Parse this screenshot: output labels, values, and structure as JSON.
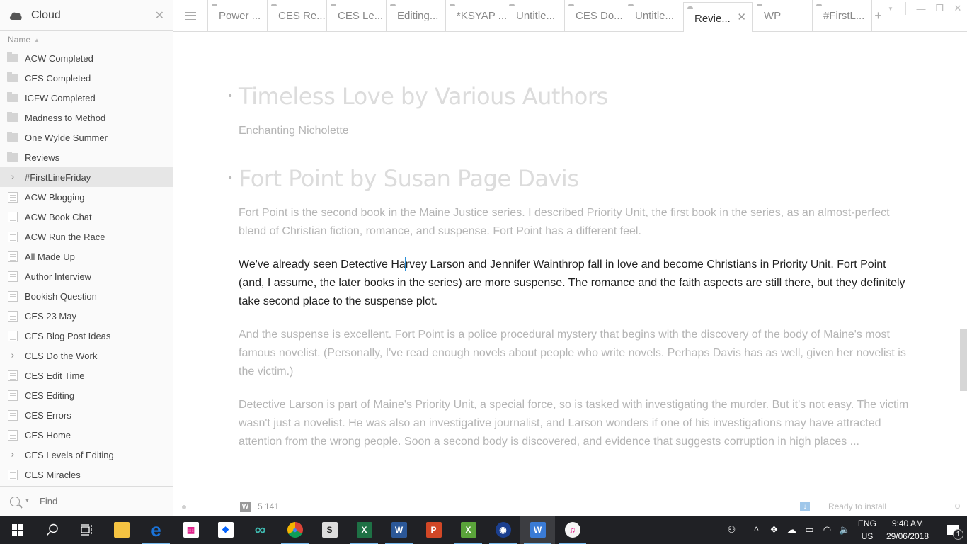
{
  "sidebar": {
    "title": "Cloud",
    "sort_label": "Name",
    "items": [
      {
        "label": "ACW Completed",
        "type": "folder"
      },
      {
        "label": "CES Completed",
        "type": "folder"
      },
      {
        "label": "ICFW Completed",
        "type": "folder"
      },
      {
        "label": "Madness to Method",
        "type": "folder"
      },
      {
        "label": "One Wylde Summer",
        "type": "folder"
      },
      {
        "label": "Reviews",
        "type": "folder"
      },
      {
        "label": "#FirstLineFriday",
        "type": "expandable",
        "selected": true
      },
      {
        "label": "ACW Blogging",
        "type": "doc"
      },
      {
        "label": "ACW Book Chat",
        "type": "doc"
      },
      {
        "label": "ACW Run the Race",
        "type": "doc"
      },
      {
        "label": "All Made Up",
        "type": "doc"
      },
      {
        "label": "Author Interview",
        "type": "doc"
      },
      {
        "label": "Bookish Question",
        "type": "doc"
      },
      {
        "label": "CES 23 May",
        "type": "doc"
      },
      {
        "label": "CES Blog Post Ideas",
        "type": "doc"
      },
      {
        "label": "CES Do the Work",
        "type": "expandable"
      },
      {
        "label": "CES Edit Time",
        "type": "doc"
      },
      {
        "label": "CES Editing",
        "type": "doc"
      },
      {
        "label": "CES Errors",
        "type": "doc"
      },
      {
        "label": "CES Home",
        "type": "doc"
      },
      {
        "label": "CES Levels of Editing",
        "type": "expandable"
      },
      {
        "label": "CES Miracles",
        "type": "doc"
      }
    ],
    "find_placeholder": "Find"
  },
  "tabs": [
    {
      "label": "Power ..."
    },
    {
      "label": "CES Re..."
    },
    {
      "label": "CES Le..."
    },
    {
      "label": "Editing..."
    },
    {
      "label": "*KSYAP ..."
    },
    {
      "label": "Untitle..."
    },
    {
      "label": "CES Do..."
    },
    {
      "label": "Untitle..."
    },
    {
      "label": "Revie...",
      "active": true
    },
    {
      "label": "WP"
    },
    {
      "label": "#FirstL..."
    }
  ],
  "document": {
    "heading1": "Timeless Love by Various Authors",
    "subtext1": "Enchanting Nicholette",
    "heading2": "Fort Point by Susan Page Davis",
    "para1": "Fort Point is the second book in the Maine Justice series. I described Priority Unit, the first book in the series, as an almost-perfect blend of Christian fiction, romance, and suspense. Fort Point has a different feel.",
    "para2_before_caret": "We've already seen Detective Ha",
    "para2_after_caret": "rvey Larson and Jennifer Wainthrop fall in love and become Christians in Priority Unit. Fort Point (and, I assume, the later books in the series) are more suspense. The romance and the faith aspects are still there, but they definitely take second place to the suspense plot.",
    "para3": "And the suspense is excellent. Fort Point is a police procedural mystery that begins with the discovery of the body of Maine's most famous novelist. (Personally, I've read enough novels about people who write novels. Perhaps Davis has as well, given her novelist is the victim.)",
    "para4": "Detective Larson is part of Maine's Priority Unit, a special force, so is tasked with investigating the murder. But it's not easy. The victim wasn't just a novelist. He was also an investigative journalist, and Larson wonders if one of his investigations may have attracted attention from the wrong people. Soon a second body is discovered, and evidence that suggests corruption in high places ..."
  },
  "status": {
    "word_icon": "W",
    "word_count": "5 141",
    "update_text": "Ready to install"
  },
  "taskbar": {
    "apps": [
      {
        "name": "file-explorer",
        "running": false
      },
      {
        "name": "edge",
        "running": true
      },
      {
        "name": "store",
        "running": false
      },
      {
        "name": "dropbox",
        "running": false
      },
      {
        "name": "infinity-app",
        "running": false
      },
      {
        "name": "chrome",
        "running": true
      },
      {
        "name": "scrivener",
        "running": false
      },
      {
        "name": "excel",
        "running": true
      },
      {
        "name": "word",
        "running": true
      },
      {
        "name": "powerpoint",
        "running": false
      },
      {
        "name": "excel-viewer",
        "running": true
      },
      {
        "name": "globe-app",
        "running": true
      },
      {
        "name": "writer",
        "running": true,
        "active": true
      },
      {
        "name": "itunes",
        "running": true
      }
    ],
    "lang_top": "ENG",
    "lang_bottom": "US",
    "time": "9:40 AM",
    "date": "29/06/2018",
    "notification_count": "1"
  }
}
